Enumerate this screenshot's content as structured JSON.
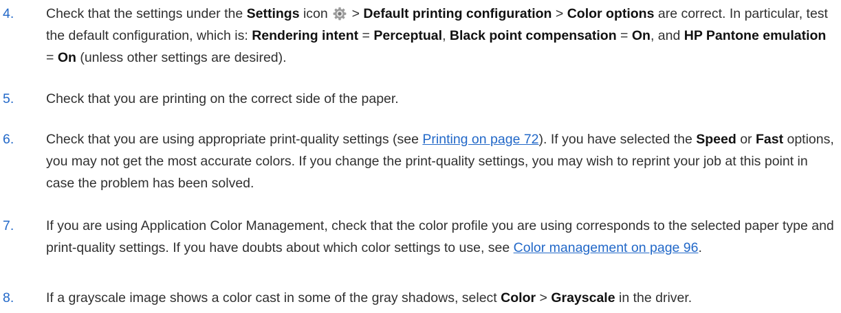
{
  "accent_color": "#2268c8",
  "steps": [
    {
      "number": "4.",
      "s1": "Check that the settings under the ",
      "b1": "Settings",
      "s2": " icon",
      "s3": " > ",
      "b2": "Default printing configuration",
      "s4": " > ",
      "b3": "Color options",
      "s5": " are correct. In particular, test the default configuration, which is: ",
      "b4": "Rendering intent",
      "s6": " = ",
      "b5": "Perceptual",
      "s7": ", ",
      "b6": "Black point compensation",
      "s8": " = ",
      "b7": "On",
      "s9": ", and ",
      "b8": "HP Pantone emulation",
      "s10": " = ",
      "b9": "On",
      "s11": " (unless other settings are desired).",
      "icon": "gear-icon"
    },
    {
      "number": "5.",
      "text": "Check that you are printing on the correct side of the paper."
    },
    {
      "number": "6.",
      "s1": "Check that you are using appropriate print-quality settings (see ",
      "link": "Printing on page 72",
      "s2": "). If you have selected the ",
      "b1": "Speed",
      "s3": " or ",
      "b2": "Fast",
      "s4": " options, you may not get the most accurate colors. If you change the print-quality settings, you may wish to reprint your job at this point in case the problem has been solved."
    },
    {
      "number": "7.",
      "s1": "If you are using Application Color Management, check that the color profile you are using corresponds to the selected paper type and print-quality settings. If you have doubts about which color settings to use, see ",
      "link": "Color management on page 96",
      "s2": "."
    },
    {
      "number": "8.",
      "s1": "If a grayscale image shows a color cast in some of the gray shadows, select ",
      "b1": "Color",
      "s2": " > ",
      "b2": "Grayscale",
      "s3": " in the driver."
    }
  ]
}
